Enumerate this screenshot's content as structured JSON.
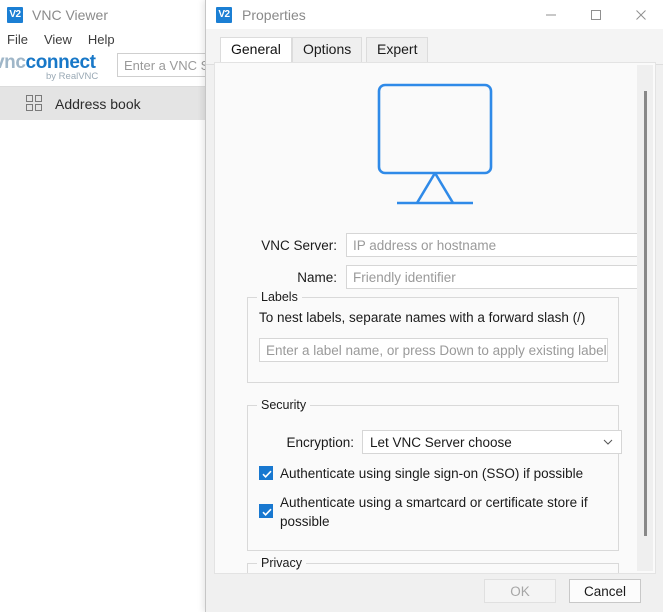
{
  "viewer": {
    "title": "VNC Viewer",
    "app_icon": "V2",
    "menu": [
      {
        "label": "File"
      },
      {
        "label": "View"
      },
      {
        "label": "Help"
      }
    ],
    "logo": {
      "part1": "vnc",
      "part2": "connect",
      "subtitle": "by RealVNC"
    },
    "search": {
      "placeholder": "Enter a VNC Server address or search",
      "value": "Enter a VNC Se"
    },
    "address_book": {
      "label": "Address book",
      "icon": "grid-icon"
    }
  },
  "dialog": {
    "title": "Properties",
    "app_icon": "V2",
    "window_controls": {
      "minimize": "minimize-icon",
      "maximize": "maximize-icon",
      "close": "close-icon"
    },
    "tabs": [
      {
        "label": "General",
        "active": true
      },
      {
        "label": "Options",
        "active": false
      },
      {
        "label": "Expert",
        "active": false
      }
    ],
    "hero_icon": "monitor-icon",
    "fields": {
      "server_label": "VNC Server:",
      "server_placeholder": "IP address or hostname",
      "name_label": "Name:",
      "name_placeholder": "Friendly identifier"
    },
    "labels_group": {
      "title": "Labels",
      "hint": "To nest labels, separate names with a forward slash (/)",
      "input_placeholder": "Enter a label name, or press Down to apply existing labels"
    },
    "security_group": {
      "title": "Security",
      "encryption_label": "Encryption:",
      "encryption_value": "Let VNC Server choose",
      "encryption_options": [
        "Let VNC Server choose"
      ],
      "sso_checkbox": {
        "label": "Authenticate using single sign-on (SSO) if possible",
        "checked": true
      },
      "smartcard_checkbox": {
        "label": "Authenticate using a smartcard or certificate store if possible",
        "checked": true
      }
    },
    "privacy_group": {
      "title": "Privacy"
    },
    "footer": {
      "ok_label": "OK",
      "ok_disabled": true,
      "cancel_label": "Cancel"
    },
    "scrollbar": {
      "orientation": "vertical"
    }
  },
  "colors": {
    "accent_blue": "#1878d0",
    "logo_blue": "#1878c8",
    "monitor_blue": "#2f8ae8",
    "titlebar_text": "#8a8a8a",
    "dialog_bg": "#f0f0f0",
    "content_bg": "#fafafa",
    "addressbar_bg": "#e4e4e4"
  }
}
